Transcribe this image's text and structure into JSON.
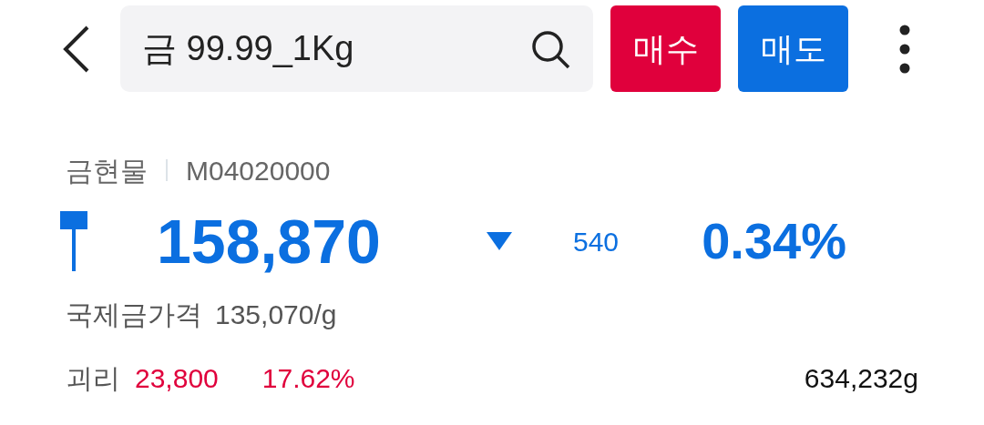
{
  "header": {
    "search": {
      "value": "금 99.99_1Kg"
    },
    "buttons": [
      {
        "label": "매수",
        "kind": "buy"
      },
      {
        "label": "매도",
        "kind": "sell"
      }
    ]
  },
  "instrument": {
    "category": "금현물",
    "code": "M04020000"
  },
  "quote": {
    "falling": true,
    "price": "158,870",
    "change": "540",
    "change_rate": "0.34%"
  },
  "international": {
    "label": "국제금가격",
    "value": "135,070/g"
  },
  "premium": {
    "label": "괴리",
    "amount": "23,800",
    "rate": "17.62%",
    "volume": "634,232g"
  }
}
